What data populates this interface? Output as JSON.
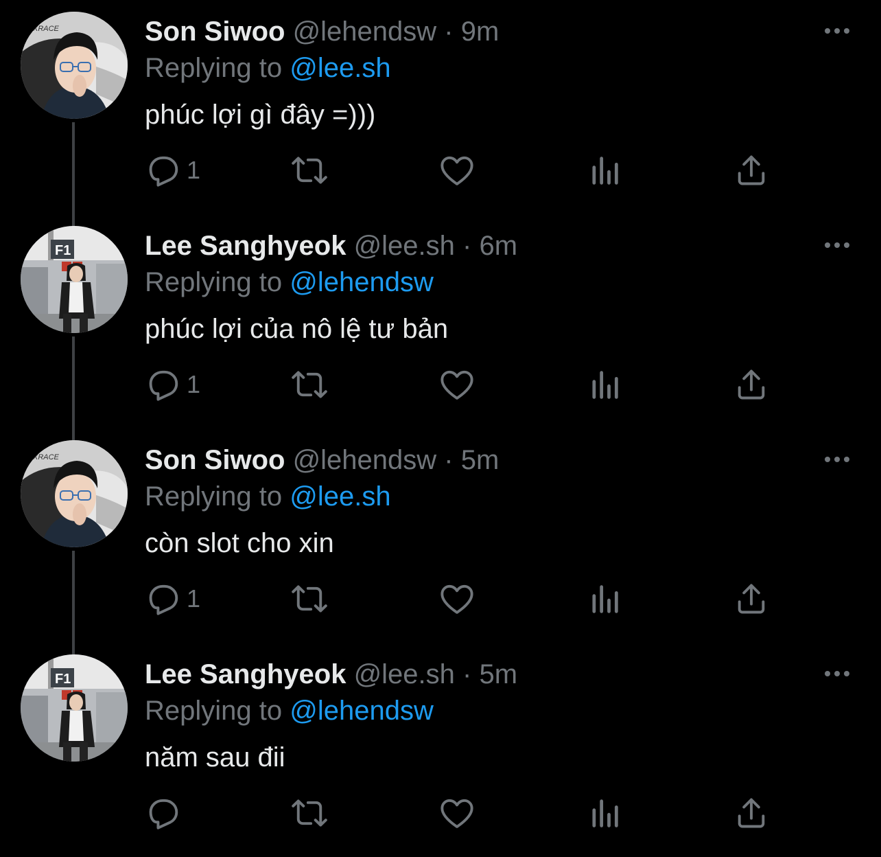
{
  "tweets": [
    {
      "name": "Son Siwoo",
      "handle": "@lehendsw",
      "separator": "·",
      "time": "9m",
      "replying_prefix": "Replying to",
      "replying_to": "@lee.sh",
      "text": "phúc lợi gì đây =)))",
      "reply_count": "1",
      "avatar": "avatar-son-siwoo"
    },
    {
      "name": "Lee Sanghyeok",
      "handle": "@lee.sh",
      "separator": "·",
      "time": "6m",
      "replying_prefix": "Replying to",
      "replying_to": "@lehendsw",
      "text": "phúc lợi của nô lệ tư bản",
      "reply_count": "1",
      "avatar": "avatar-lee-sanghyeok"
    },
    {
      "name": "Son Siwoo",
      "handle": "@lehendsw",
      "separator": "·",
      "time": "5m",
      "replying_prefix": "Replying to",
      "replying_to": "@lee.sh",
      "text": "còn slot cho xin",
      "reply_count": "1",
      "avatar": "avatar-son-siwoo"
    },
    {
      "name": "Lee Sanghyeok",
      "handle": "@lee.sh",
      "separator": "·",
      "time": "5m",
      "replying_prefix": "Replying to",
      "replying_to": "@lehendsw",
      "text": "năm sau đii",
      "reply_count": "",
      "avatar": "avatar-lee-sanghyeok"
    }
  ],
  "avatar_text": {
    "son_siwoo_chair": "XRACE",
    "lee_sanghyeok_sign": "F1"
  },
  "icons": {
    "more": "more-horizontal-icon",
    "reply": "reply-icon",
    "retweet": "retweet-icon",
    "like": "like-icon",
    "views": "views-icon",
    "share": "share-icon"
  },
  "colors": {
    "background": "#000000",
    "primary_text": "#e7e9ea",
    "secondary_text": "#71767b",
    "accent": "#1d9bf0",
    "thread_line": "#3e4144"
  }
}
